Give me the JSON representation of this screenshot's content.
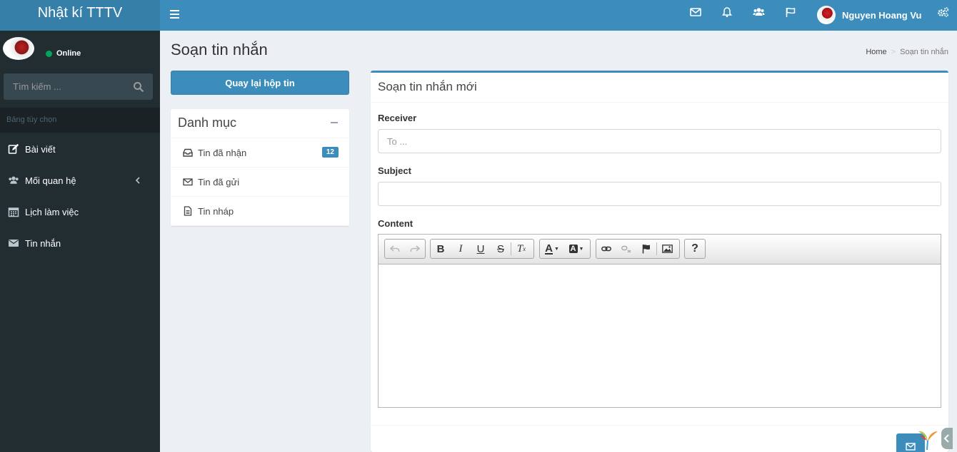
{
  "header": {
    "logo": "Nhật kí TTTV",
    "user_name": "Nguyen Hoang Vu",
    "icons": [
      "envelope-icon",
      "bell-icon",
      "users-icon",
      "flag-icon",
      "gears-icon"
    ]
  },
  "sidebar": {
    "status": "Online",
    "search_placeholder": "Tìm kiếm ...",
    "section_header": "Bảng tùy chọn",
    "items": [
      {
        "label": "Bài viết",
        "icon": "edit-icon"
      },
      {
        "label": "Mối quan hệ",
        "icon": "users-icon"
      },
      {
        "label": "Lịch làm việc",
        "icon": "calendar-icon"
      },
      {
        "label": "Tin nhắn",
        "icon": "envelope-icon"
      }
    ]
  },
  "page": {
    "title": "Soạn tin nhắn",
    "breadcrumb": {
      "home": "Home",
      "current": "Soạn tin nhắn"
    }
  },
  "folders": {
    "back_button": "Quay lại hộp tin",
    "title": "Danh mục",
    "items": [
      {
        "label": "Tin đã nhận",
        "badge": "12"
      },
      {
        "label": "Tin đã gửi"
      },
      {
        "label": "Tin nháp"
      }
    ]
  },
  "compose": {
    "title": "Soạn tin nhắn mới",
    "receiver_label": "Receiver",
    "receiver_placeholder": "To ...",
    "subject_label": "Subject",
    "subject_value": "",
    "content_label": "Content"
  },
  "colors": {
    "primary": "#3c8dbc",
    "sidebar": "#222d32",
    "background": "#ecf0f5"
  }
}
